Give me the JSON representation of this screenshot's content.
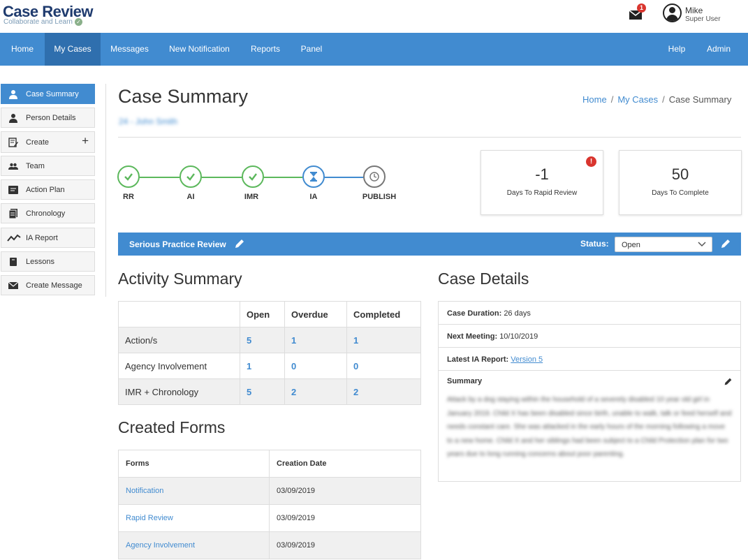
{
  "app": {
    "title": "Case Review",
    "subtitle": "Collaborate and Learn",
    "mail_badge": "1",
    "user_name": "Mike",
    "user_role": "Super User"
  },
  "nav": {
    "items": [
      "Home",
      "My Cases",
      "Messages",
      "New Notification",
      "Reports",
      "Panel"
    ],
    "right": [
      "Help",
      "Admin"
    ],
    "active": "My Cases"
  },
  "sidebar": {
    "items": [
      {
        "label": "Case Summary",
        "icon": "person-icon"
      },
      {
        "label": "Person Details",
        "icon": "person-icon"
      },
      {
        "label": "Create",
        "icon": "edit-doc-icon"
      },
      {
        "label": "Team",
        "icon": "group-icon"
      },
      {
        "label": "Action Plan",
        "icon": "list-icon"
      },
      {
        "label": "Chronology",
        "icon": "document-icon"
      },
      {
        "label": "IA Report",
        "icon": "trend-icon"
      },
      {
        "label": "Lessons",
        "icon": "book-icon"
      },
      {
        "label": "Create Message",
        "icon": "envelope-icon"
      }
    ],
    "create_plus": "+"
  },
  "page": {
    "title": "Case Summary",
    "case_link": "24 - John Smith",
    "breadcrumb": [
      "Home",
      "My Cases",
      "Case Summary"
    ],
    "breadcrumb_sep": "/"
  },
  "stepper": {
    "steps": [
      {
        "label": "RR",
        "state": "done"
      },
      {
        "label": "AI",
        "state": "done"
      },
      {
        "label": "IMR",
        "state": "done"
      },
      {
        "label": "IA",
        "state": "current"
      },
      {
        "label": "PUBLISH",
        "state": "pending"
      }
    ]
  },
  "stats": {
    "rapid_value": "-1",
    "rapid_label": "Days To Rapid Review",
    "rapid_alert": "!",
    "complete_value": "50",
    "complete_label": "Days To Complete"
  },
  "review": {
    "title": "Serious Practice Review",
    "status_label": "Status:",
    "status_value": "Open"
  },
  "activity": {
    "heading": "Activity Summary",
    "columns": [
      "Open",
      "Overdue",
      "Completed"
    ],
    "rows": [
      {
        "label": "Action/s",
        "values": [
          "5",
          "1",
          "1"
        ]
      },
      {
        "label": "Agency Involvement",
        "values": [
          "1",
          "0",
          "0"
        ]
      },
      {
        "label": "IMR + Chronology",
        "values": [
          "5",
          "2",
          "2"
        ]
      }
    ]
  },
  "forms": {
    "heading": "Created Forms",
    "columns": [
      "Forms",
      "Creation Date"
    ],
    "rows": [
      {
        "name": "Notification",
        "date": "03/09/2019"
      },
      {
        "name": "Rapid Review",
        "date": "03/09/2019"
      },
      {
        "name": "Agency Involvement",
        "date": "03/09/2019"
      }
    ]
  },
  "details": {
    "heading": "Case Details",
    "duration_label": "Case Duration:",
    "duration_value": "26 days",
    "meeting_label": "Next Meeting:",
    "meeting_value": "10/10/2019",
    "ia_label": "Latest IA Report:",
    "ia_link": "Version 5",
    "summary_label": "Summary",
    "summary_text": "Attack by a dog staying within the household of a severely disabled 10 year old girl in January 2019. Child X has been disabled since birth, unable to walk, talk or feed herself and needs constant care. She was attacked in the early hours of the morning following a move to a new home. Child X and her siblings had been subject to a Child Protection plan for two years due to long running concerns about poor parenting."
  },
  "colors": {
    "primary": "#418bd0",
    "nav_active": "#2f6fae",
    "success": "#5cb85c",
    "danger": "#d9352e"
  }
}
